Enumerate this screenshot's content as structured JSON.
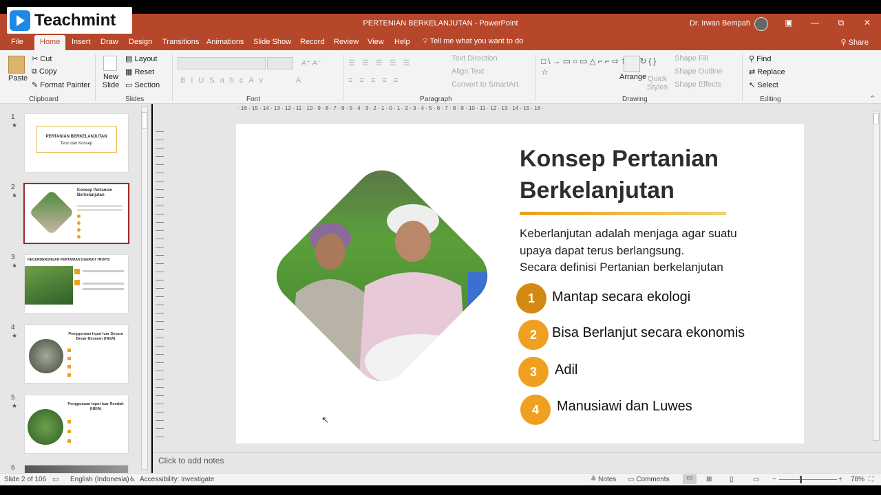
{
  "logo": {
    "text": "Teachmint"
  },
  "window": {
    "title": "PERTENIAN BERKELANJUTAN  -  PowerPoint",
    "user": "Dr. Irwan Bempah",
    "minimize": "—",
    "maximize": "⧉",
    "close": "✕",
    "ribbon_toggle": "▣"
  },
  "tabs": [
    "File",
    "Home",
    "Insert",
    "Draw",
    "Design",
    "Transitions",
    "Animations",
    "Slide Show",
    "Record",
    "Review",
    "View",
    "Help"
  ],
  "tell_me": "Tell me what you want to do",
  "share": "Share",
  "ribbon": {
    "clipboard": {
      "paste": "Paste",
      "cut": "Cut",
      "copy": "Copy",
      "format_painter": "Format Painter",
      "label": "Clipboard"
    },
    "slides": {
      "new_slide": "New Slide",
      "layout": "Layout",
      "reset": "Reset",
      "section": "Section",
      "label": "Slides"
    },
    "font": {
      "label": "Font"
    },
    "paragraph": {
      "text_direction": "Text Direction",
      "align_text": "Align Text",
      "convert": "Convert to SmartArt",
      "label": "Paragraph"
    },
    "drawing": {
      "arrange": "Arrange",
      "quick_styles": "Quick Styles",
      "shape_fill": "Shape Fill",
      "shape_outline": "Shape Outline",
      "shape_effects": "Shape Effects",
      "label": "Drawing"
    },
    "editing": {
      "find": "Find",
      "replace": "Replace",
      "select": "Select",
      "label": "Editing"
    }
  },
  "thumbnails": [
    {
      "num": "1",
      "title": "PERTANIAN BERKELANJUTAN",
      "sub": "Teori dan Konsep"
    },
    {
      "num": "2",
      "title": "Konsep Pertanian Berkelanjutan"
    },
    {
      "num": "3",
      "title": "KECENDERUNGAN PERTANIAN DAERAH TROPIS"
    },
    {
      "num": "4",
      "title": "Penggunaan Input luar Secara Besar Besaran (HEIA)"
    },
    {
      "num": "5",
      "title": "Penggunaan Input luar Rendah (HEIA)"
    },
    {
      "num": "6"
    }
  ],
  "ruler_ticks": "· 16 · 15 · 14 · 13 · 12 · 11 · 10 · 9 · 8 · 7 · 6 · 5 · 4 · 3 · 2 · 1 · 0 · 1 · 2 · 3 · 4 · 5 · 6 · 7 · 8 · 9 · 10 · 11 · 12 · 13 · 14 · 15 · 16 ·",
  "slide": {
    "title_line1": "Konsep Pertanian",
    "title_line2": "Berkelanjutan",
    "body_line1": "Keberlanjutan adalah menjaga agar suatu",
    "body_line2": "upaya dapat terus berlangsung.",
    "body_line3": "Secara definisi Pertanian berkelanjutan",
    "items": [
      {
        "num": "1",
        "text": "Mantap secara ekologi"
      },
      {
        "num": "2",
        "text": "Bisa Berlanjut secara ekonomis"
      },
      {
        "num": "3",
        "text": "Adil"
      },
      {
        "num": "4",
        "text": "Manusiawi dan Luwes"
      }
    ]
  },
  "notes_placeholder": "Click to add notes",
  "status": {
    "slide": "Slide 2 of 106",
    "language": "English (Indonesia)",
    "accessibility": "Accessibility: Investigate",
    "notes": "Notes",
    "comments": "Comments",
    "zoom": "78%"
  },
  "colors": {
    "accent": "#b7472a",
    "gold": "#f0a020"
  }
}
